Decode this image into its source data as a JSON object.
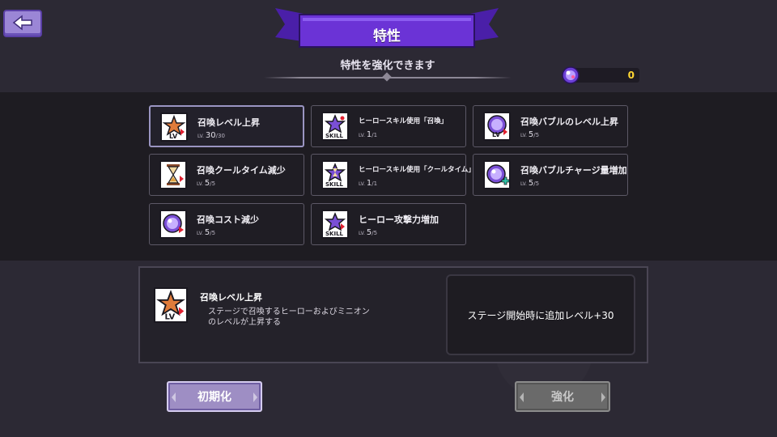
{
  "header": {
    "title": "特性",
    "subtitle": "特性を強化できます"
  },
  "currency": {
    "icon": "bubble-icon",
    "value": "0",
    "color": "#ffd633"
  },
  "traits": [
    {
      "name": "召喚レベル上昇",
      "lv_tag": "LV.",
      "level": "30",
      "max": "/30",
      "icon": "summon-level-icon",
      "selected": true
    },
    {
      "name": "ヒーロースキル使用「召喚」",
      "lv_tag": "LV.",
      "level": "1",
      "max": "/1",
      "icon": "skill-icon"
    },
    {
      "name": "召喚バブルのレベル上昇",
      "lv_tag": "LV.",
      "level": "5",
      "max": "/5",
      "icon": "bubble-level-icon"
    },
    {
      "name": "召喚クールタイム減少",
      "lv_tag": "LV.",
      "level": "5",
      "max": "/5",
      "icon": "hourglass-icon"
    },
    {
      "name": "ヒーロースキル使用「クールタイム」",
      "lv_tag": "LV.",
      "level": "1",
      "max": "/1",
      "icon": "skill-cooldown-icon"
    },
    {
      "name": "召喚バブルチャージ量増加",
      "lv_tag": "LV.",
      "level": "5",
      "max": "/5",
      "icon": "bubble-charge-icon"
    },
    {
      "name": "召喚コスト減少",
      "lv_tag": "LV.",
      "level": "5",
      "max": "/5",
      "icon": "summon-cost-icon"
    },
    {
      "name": "ヒーロー攻撃力増加",
      "lv_tag": "LV.",
      "level": "5",
      "max": "/5",
      "icon": "skill-attack-icon"
    }
  ],
  "detail": {
    "name": "召喚レベル上昇",
    "description": "ステージで召喚するヒーローおよびミニオンのレベルが上昇する",
    "effect": "ステージ開始時に追加レベル+30"
  },
  "buttons": {
    "reset_label": "初期化",
    "enhance_label": "強化"
  },
  "colors": {
    "banner": "#6b33d6",
    "accent_gold": "#ffd633",
    "card_border": "#5c5866"
  }
}
